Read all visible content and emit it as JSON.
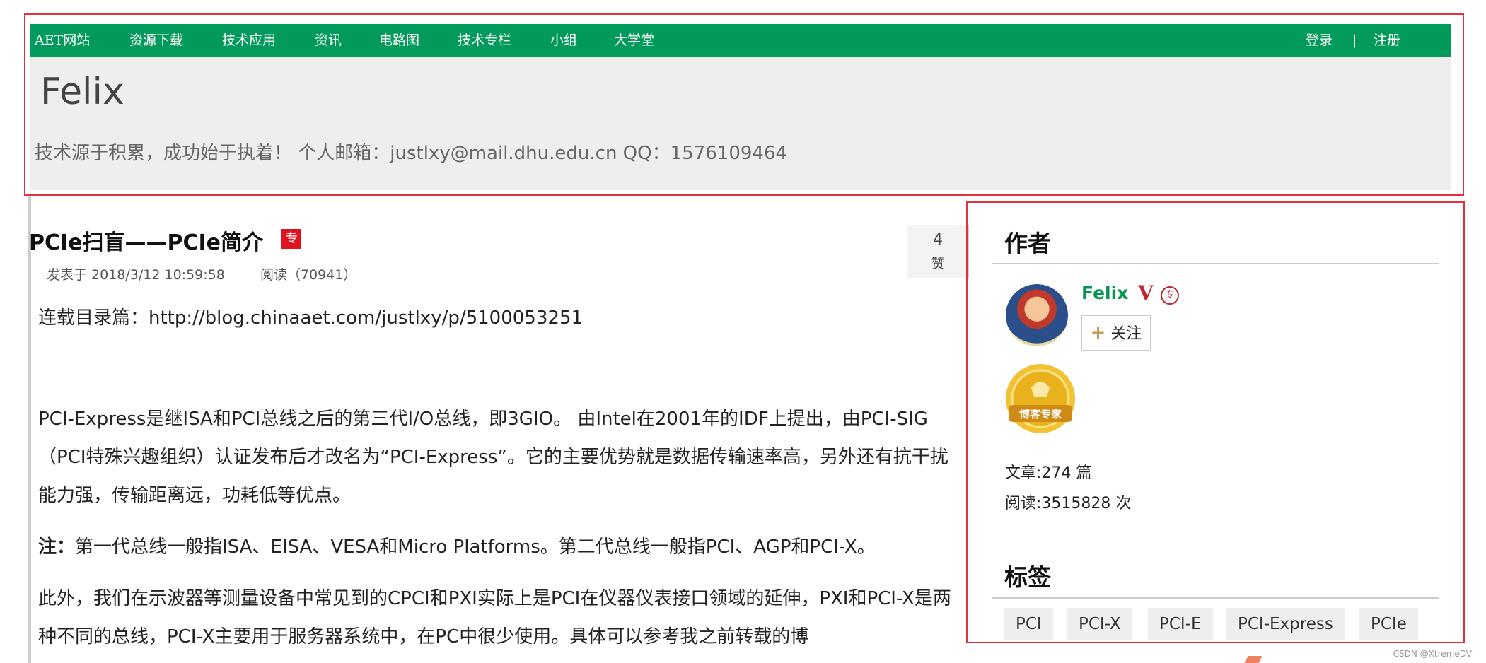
{
  "topnav": {
    "items": [
      "AET网站",
      "资源下载",
      "技术应用",
      "资讯",
      "电路图",
      "技术专栏",
      "小组",
      "大学堂"
    ],
    "login": "登录",
    "separator": "|",
    "register": "注册"
  },
  "blog": {
    "title": "Felix",
    "subtitle": "技术源于积累，成功始于执着！ 个人邮箱：justlxy@mail.dhu.edu.cn QQ：1576109464"
  },
  "article": {
    "title": "PCIe扫盲——PCIe简介",
    "badge": "专",
    "published": "发表于 2018/3/12 10:59:58",
    "reads": "阅读（70941）",
    "likes": "4",
    "like_label": "赞",
    "paragraphs": {
      "p1": "连载目录篇：http://blog.chinaaet.com/justlxy/p/5100053251",
      "p2": "PCI-Express是继ISA和PCI总线之后的第三代I/O总线，即3GIO。 由Intel在2001年的IDF上提出，由PCI-SIG（PCI特殊兴趣组织）认证发布后才改名为“PCI-Express”。它的主要优势就是数据传输速率高，另外还有抗干扰能力强，传输距离远，功耗低等优点。",
      "p3_label": "注：",
      "p3": "第一代总线一般指ISA、EISA、VESA和Micro Platforms。第二代总线一般指PCI、AGP和PCI-X。",
      "p4": "此外，我们在示波器等测量设备中常见到的CPCI和PXI实际上是PCI在仪器仪表接口领域的延伸，PXI和PCI-X是两种不同的总线，PCI-X主要用于服务器系统中，在PC中很少使用。具体可以参考我之前转载的博"
    }
  },
  "sidebar": {
    "author_heading": "作者",
    "author_name": "Felix",
    "v_badge": "V",
    "zhuan_badge": "专",
    "follow_label": "关注",
    "follow_plus": "+",
    "medal_text": "博客专家",
    "articles_stat": "文章:274 篇",
    "reads_stat": "阅读:3515828 次",
    "tags_heading": "标签",
    "tags": [
      "PCI",
      "PCI-X",
      "PCI-E",
      "PCI-Express",
      "PCIe"
    ]
  },
  "watermark": "CSDN @XtremeDV",
  "colors": {
    "nav_green": "#029a5a",
    "annotation_red": "#e0323c",
    "badge_red": "#e0121e",
    "author_green": "#02944f"
  }
}
